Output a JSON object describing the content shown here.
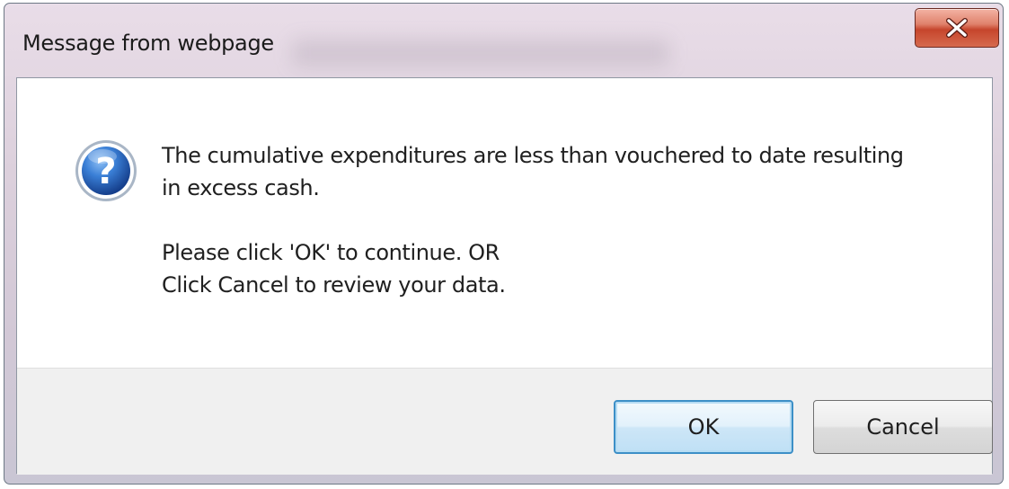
{
  "dialog": {
    "title": "Message from webpage",
    "close_icon": "close-icon",
    "icon": "question-icon",
    "message": {
      "line1": "The cumulative expenditures are less than vouchered to date resulting",
      "line2": "in excess cash.",
      "line3": "Please click 'OK' to continue. OR",
      "line4": "Click Cancel to review your data."
    },
    "buttons": {
      "ok_label": "OK",
      "cancel_label": "Cancel"
    }
  },
  "colors": {
    "close_button": "#c6452c",
    "default_button_border": "#3c8fc7",
    "question_icon": "#1f5fb3"
  }
}
